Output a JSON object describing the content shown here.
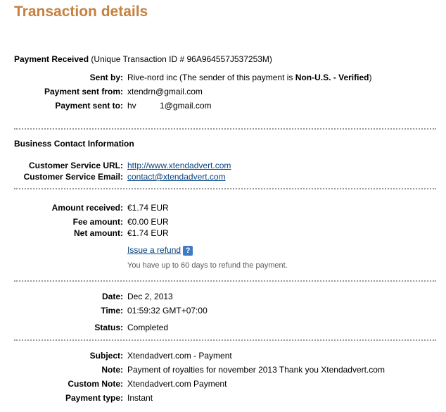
{
  "page_title": "Transaction details",
  "payment": {
    "heading": "Payment Received",
    "transaction_id_text": "(Unique Transaction ID # 96A964557J537253M)",
    "sent_by_label": "Sent by:",
    "sent_by_value": "Rive-nord inc (The sender of this payment is ",
    "sent_by_status": "Non-U.S. - Verified",
    "sent_by_close": ")",
    "from_label": "Payment sent from:",
    "from_value": "xtendrn@gmail.com",
    "to_label": "Payment sent to:",
    "to_value": "hv          1@gmail.com"
  },
  "business": {
    "heading": "Business Contact Information",
    "url_label": "Customer Service URL:",
    "url_value": "http://www.xtendadvert.com",
    "email_label": "Customer Service Email:",
    "email_value": "contact@xtendadvert.com"
  },
  "amounts": {
    "received_label": "Amount received:",
    "received_value": "€1.74 EUR",
    "fee_label": "Fee amount:",
    "fee_value": "€0.00 EUR",
    "net_label": "Net amount:",
    "net_value": "€1.74 EUR",
    "refund_link": "Issue a refund",
    "help_glyph": "?",
    "refund_note": "You have up to 60 days to refund the payment."
  },
  "status": {
    "date_label": "Date:",
    "date_value": "Dec 2, 2013",
    "time_label": "Time:",
    "time_value": "01:59:32 GMT+07:00",
    "status_label": "Status:",
    "status_value": "Completed"
  },
  "details": {
    "subject_label": "Subject:",
    "subject_value": "Xtendadvert.com - Payment",
    "note_label": "Note:",
    "note_value": "Payment of royalties for november 2013 Thank you Xtendadvert.com",
    "custom_note_label": "Custom Note:",
    "custom_note_value": "Xtendadvert.com Payment",
    "payment_type_label": "Payment type:",
    "payment_type_value": "Instant"
  },
  "colors": {
    "title": "#c5813f",
    "link": "#084482",
    "help_icon_bg": "#3f7bc3",
    "separator": "#9a9a9a"
  },
  "icons": {
    "help": "help-icon"
  }
}
